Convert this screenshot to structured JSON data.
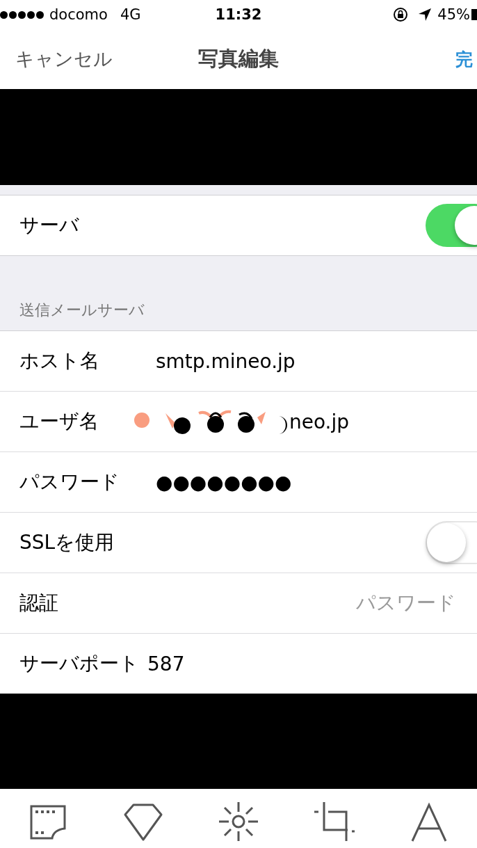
{
  "status_bar": {
    "carrier": "docomo",
    "network": "4G",
    "time": "11:32",
    "battery": "45%"
  },
  "nav": {
    "cancel": "キャンセル",
    "title": "写真編集",
    "done": "完"
  },
  "settings": {
    "top_rows": [
      {
        "kind": "toggle",
        "label": "サーバ",
        "on": true
      }
    ],
    "section_header": "送信メールサーバ",
    "rows": [
      {
        "kind": "value",
        "label": "ホスト名",
        "value": "smtp.mineo.jp"
      },
      {
        "kind": "obscured",
        "label": "ユーザ名",
        "value": "neo.jp"
      },
      {
        "kind": "value",
        "label": "パスワード",
        "value": "●●●●●●●●"
      },
      {
        "kind": "toggle",
        "label": "SSLを使用",
        "on": false
      },
      {
        "kind": "detail",
        "label": "認証",
        "value": "パスワード"
      },
      {
        "kind": "value",
        "label": "サーバポート",
        "value": "587"
      }
    ]
  }
}
